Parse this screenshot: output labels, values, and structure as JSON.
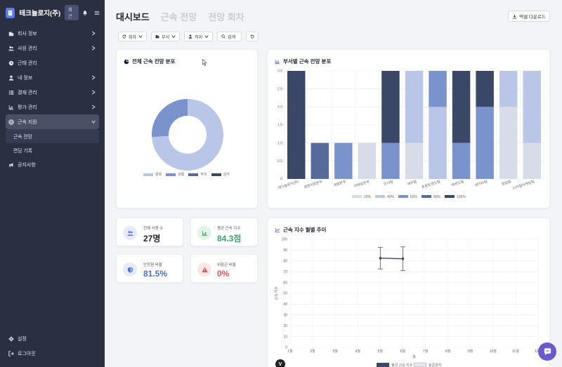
{
  "brand": {
    "name": "테크놀로지(주)",
    "badge": "최근"
  },
  "sidebar": {
    "items": [
      {
        "label": "회사 정보",
        "icon": "building-icon"
      },
      {
        "label": "사원 관리",
        "icon": "users-icon"
      },
      {
        "label": "근태 관리",
        "icon": "clock-icon"
      },
      {
        "label": "내 정보",
        "icon": "user-icon"
      },
      {
        "label": "결재 관리",
        "icon": "list-check-icon"
      },
      {
        "label": "평가 관리",
        "icon": "chart-icon"
      },
      {
        "label": "근속 지원",
        "icon": "globe-icon"
      }
    ],
    "sub_items": [
      {
        "label": "근속 전망"
      },
      {
        "label": "면담 기록"
      }
    ],
    "notice": {
      "label": "공지사항"
    },
    "bottom": [
      {
        "label": "설정"
      },
      {
        "label": "로그아웃"
      }
    ]
  },
  "header": {
    "tabs": [
      {
        "label": "대시보드"
      },
      {
        "label": "근속 전망"
      },
      {
        "label": "전망 회차"
      }
    ],
    "excel_button": "엑셀 다운로드"
  },
  "filters": [
    {
      "label": "회차"
    },
    {
      "label": "부서"
    },
    {
      "label": "직위"
    },
    {
      "label": "검색"
    }
  ],
  "donut_card": {
    "title": "전체 근속 전망 분포",
    "chart_data": {
      "type": "pie",
      "labels": [
        "양호",
        "보통",
        "주의",
        "심각"
      ],
      "values": [
        74,
        26,
        0,
        0
      ],
      "colors": [
        "#b9c6e8",
        "#7a93cc",
        "#566a9c",
        "#3a4766"
      ]
    }
  },
  "bar_card": {
    "title": "부서별 근속 전망 분포",
    "chart_data": {
      "type": "bar",
      "categories": [
        "테크놀로지(주)",
        "경영지원본부",
        "개발본부",
        "마케팅본부",
        "인사팀",
        "재무팀",
        "프론트엔드팀",
        "백엔드팀",
        "데이터팀",
        "영업팀",
        "디지털마케팅팀"
      ],
      "series": [
        {
          "name": "20%",
          "values": [
            0,
            0,
            0,
            1,
            0,
            1,
            0,
            0,
            0,
            2,
            1
          ]
        },
        {
          "name": "40%",
          "values": [
            0,
            0,
            0,
            0,
            0,
            2,
            2,
            0,
            0,
            1,
            2
          ]
        },
        {
          "name": "60%",
          "values": [
            0,
            0,
            1,
            0,
            1,
            0,
            1,
            1,
            2,
            0,
            0
          ]
        },
        {
          "name": "80%",
          "values": [
            0,
            1,
            0,
            0,
            0,
            0,
            0,
            0,
            0,
            0,
            0
          ]
        },
        {
          "name": "100%",
          "values": [
            3,
            0,
            0,
            0,
            2,
            0,
            0,
            2,
            1,
            0,
            0
          ]
        }
      ],
      "colors": [
        "#d8dce8",
        "#b9c6e8",
        "#7a93cc",
        "#566a9c",
        "#3a4766"
      ],
      "ylim": [
        0,
        3.0
      ],
      "yticks": [
        "0",
        "0.5",
        "1.0",
        "1.5",
        "2.0",
        "2.5",
        "3.0"
      ]
    }
  },
  "stats": [
    {
      "label": "전체 사원 수",
      "value": "27명",
      "color": "#1f2330",
      "icon": "users-icon",
      "bg": "#e6ebf7",
      "fg": "#5b7be8"
    },
    {
      "label": "평균 근속 지수",
      "value": "84.3점",
      "color": "#3aa56a",
      "icon": "chart-icon",
      "bg": "#e3f5e9",
      "fg": "#3aa56a"
    },
    {
      "label": "안정형 비율",
      "value": "81.5%",
      "color": "#4a6fcf",
      "icon": "shield-icon",
      "bg": "#e6ebf7",
      "fg": "#4a6fcf"
    },
    {
      "label": "위험군 비율",
      "value": "0%",
      "color": "#e05555",
      "icon": "warning-icon",
      "bg": "#fbe6e6",
      "fg": "#d94b4b"
    }
  ],
  "line_card": {
    "title": "근속 지수 월별 추이",
    "chart_data": {
      "type": "line",
      "x": [
        "1월",
        "2월",
        "3월",
        "4월",
        "5월",
        "6월",
        "7월",
        "8월",
        "9월",
        "10월",
        "11월",
        "12월"
      ],
      "series": [
        {
          "name": "평균 근속 지수",
          "values": [
            null,
            null,
            null,
            null,
            82.5,
            82.0,
            null,
            null,
            null,
            null,
            null,
            null
          ]
        },
        {
          "name": "표준편차",
          "values": [
            null,
            null,
            null,
            null,
            10,
            11,
            null,
            null,
            null,
            null,
            null,
            null
          ]
        }
      ],
      "ylim": [
        0,
        100
      ],
      "yticks": [
        "0",
        "10",
        "20",
        "30",
        "40",
        "50",
        "60",
        "70",
        "80",
        "90",
        "100"
      ],
      "xlabel": "월",
      "ylabel": "근속 지수",
      "grid": true
    }
  }
}
